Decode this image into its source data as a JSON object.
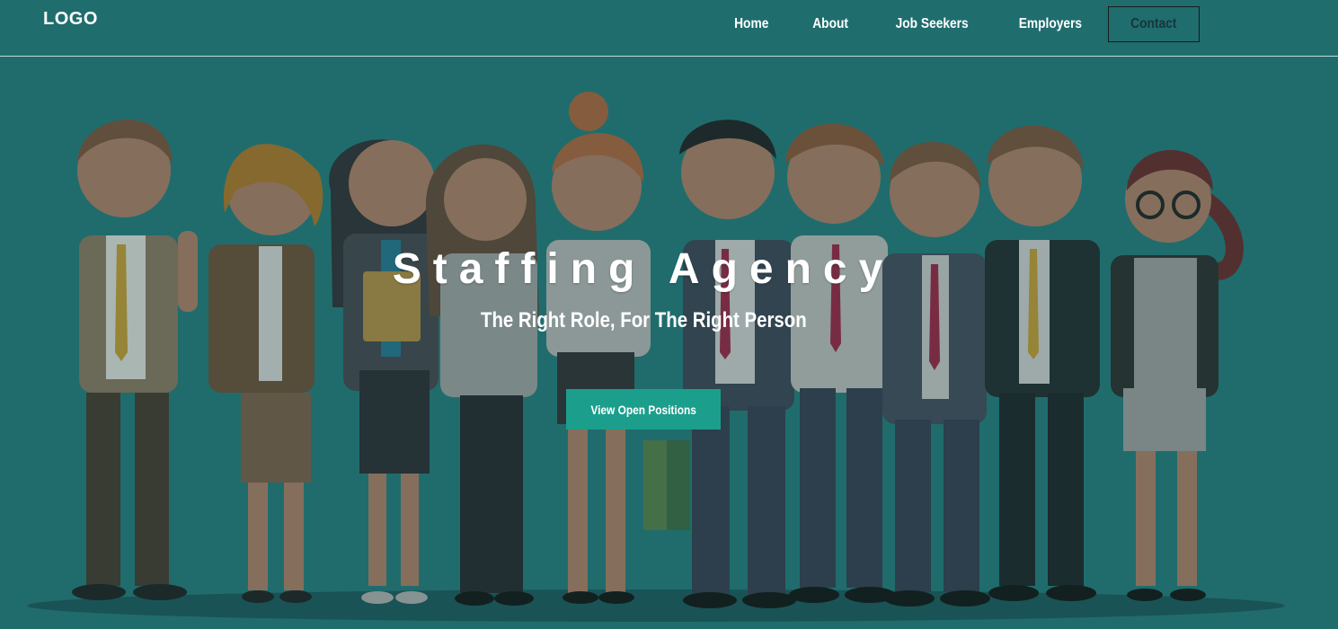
{
  "header": {
    "logo": "LOGO",
    "nav": {
      "home": "Home",
      "about": "About",
      "job_seekers": "Job Seekers",
      "employers": "Employers",
      "contact": "Contact"
    }
  },
  "hero": {
    "title": "Staffing Agency",
    "subtitle": "The Right Role, For The Right Person",
    "cta_label": "View Open Positions"
  },
  "illustration": {
    "subject": "group-of-cartoon-office-workers",
    "icon": "people-illustration"
  },
  "colors": {
    "background": "#206d6e",
    "accent": "#1b9f8c",
    "text": "#ffffff",
    "contact_border": "#1a1a1a"
  }
}
